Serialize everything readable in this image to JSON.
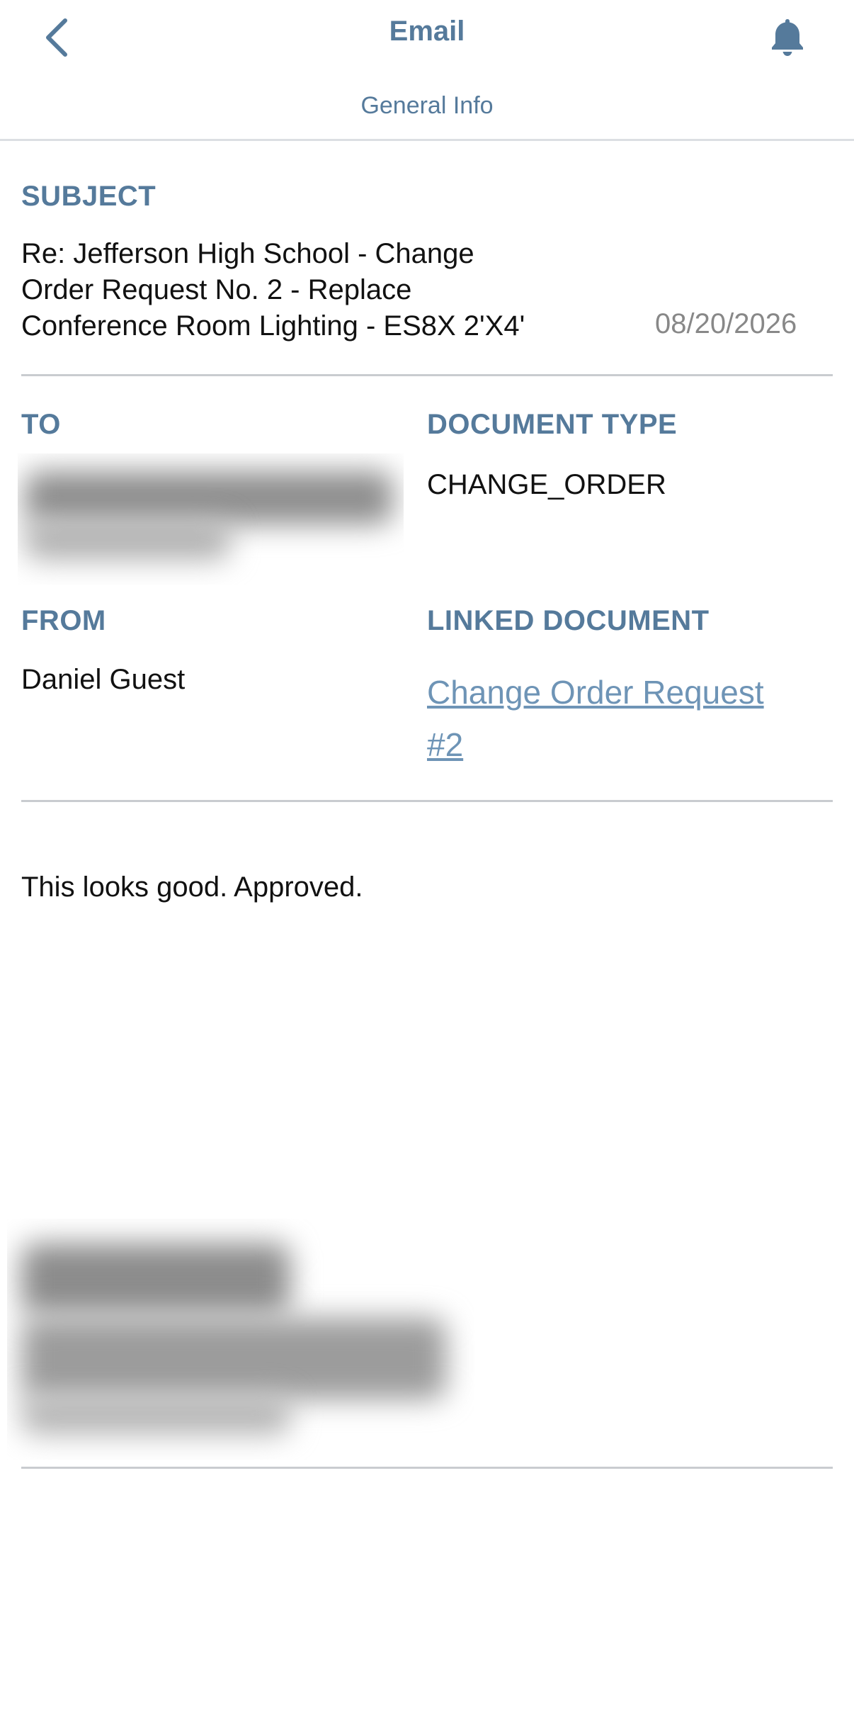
{
  "header": {
    "title": "Email",
    "tab": "General Info",
    "back_icon": "chevron-left-icon",
    "bell_icon": "bell-icon",
    "accent_color": "#557a9b"
  },
  "subject": {
    "label": "SUBJECT",
    "lines": [
      "Re: Jefferson High School - Change",
      "Order Request No. 2 - Replace",
      "Conference Room Lighting - ES8X 2'X4'"
    ],
    "date": "08/20/2026"
  },
  "to": {
    "label": "TO"
  },
  "document_type": {
    "label": "DOCUMENT TYPE",
    "value": "CHANGE_ORDER"
  },
  "from": {
    "label": "FROM",
    "value": "Daniel Guest"
  },
  "linked_document": {
    "label": "LINKED DOCUMENT",
    "link_lines": [
      "Change Order Request",
      "#2"
    ],
    "link_color": "#6e94b6"
  },
  "message": {
    "body": "This looks good. Approved."
  }
}
